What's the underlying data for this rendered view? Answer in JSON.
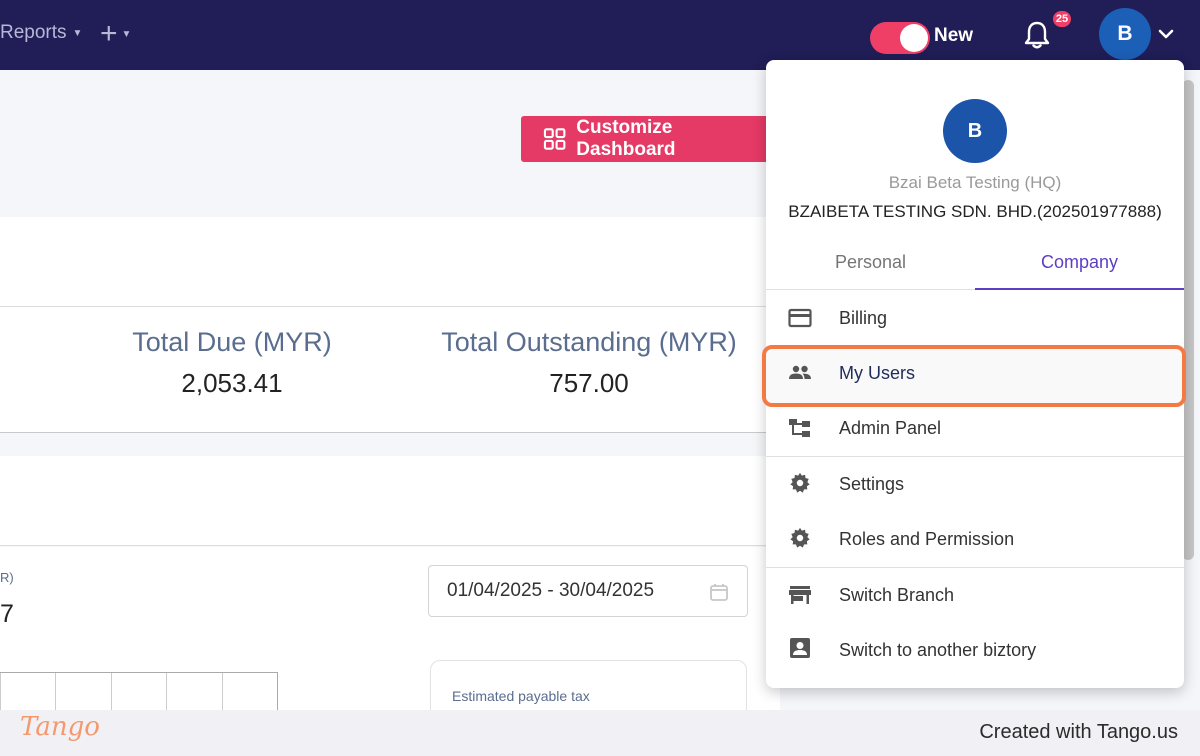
{
  "topbar": {
    "reports_label": "Reports",
    "new_toggle_label": "New",
    "notification_count": "25",
    "avatar_initial": "B"
  },
  "dashboard": {
    "customize_button_label": "Customize Dashboard",
    "totals": [
      {
        "label": "Total Due (MYR)",
        "value": "2,053.41"
      },
      {
        "label": "Total Outstanding (MYR)",
        "value": "757.00"
      }
    ],
    "partial_label_fragment": "R)",
    "partial_value_fragment": "7",
    "date_range": "01/04/2025 - 30/04/2025",
    "tax_card_label": "Estimated payable tax"
  },
  "profile_menu": {
    "avatar_initial": "B",
    "branch_name": "Bzai Beta Testing (HQ)",
    "company_name": "BZAIBETA TESTING SDN. BHD.(202501977888)",
    "tabs": [
      {
        "label": "Personal",
        "active": false
      },
      {
        "label": "Company",
        "active": true
      }
    ],
    "items": [
      {
        "label": "Billing",
        "icon": "credit-card-icon"
      },
      {
        "label": "My Users",
        "icon": "users-icon",
        "highlighted": true
      },
      {
        "label": "Admin Panel",
        "icon": "hierarchy-icon"
      },
      {
        "label": "Settings",
        "icon": "gear-icon"
      },
      {
        "label": "Roles and Permission",
        "icon": "gear-icon"
      },
      {
        "label": "Switch Branch",
        "icon": "store-icon"
      },
      {
        "label": "Switch to another biztory",
        "icon": "account-box-icon"
      }
    ]
  },
  "footer": {
    "logo_text": "Tango",
    "credit_text": "Created with Tango.us"
  },
  "colors": {
    "topbar": "#201d57",
    "accent_pink": "#e53966",
    "company_tab_purple": "#5f3dc4",
    "highlight_orange": "#f47a45",
    "avatar_blue": "#1c5fb6"
  }
}
